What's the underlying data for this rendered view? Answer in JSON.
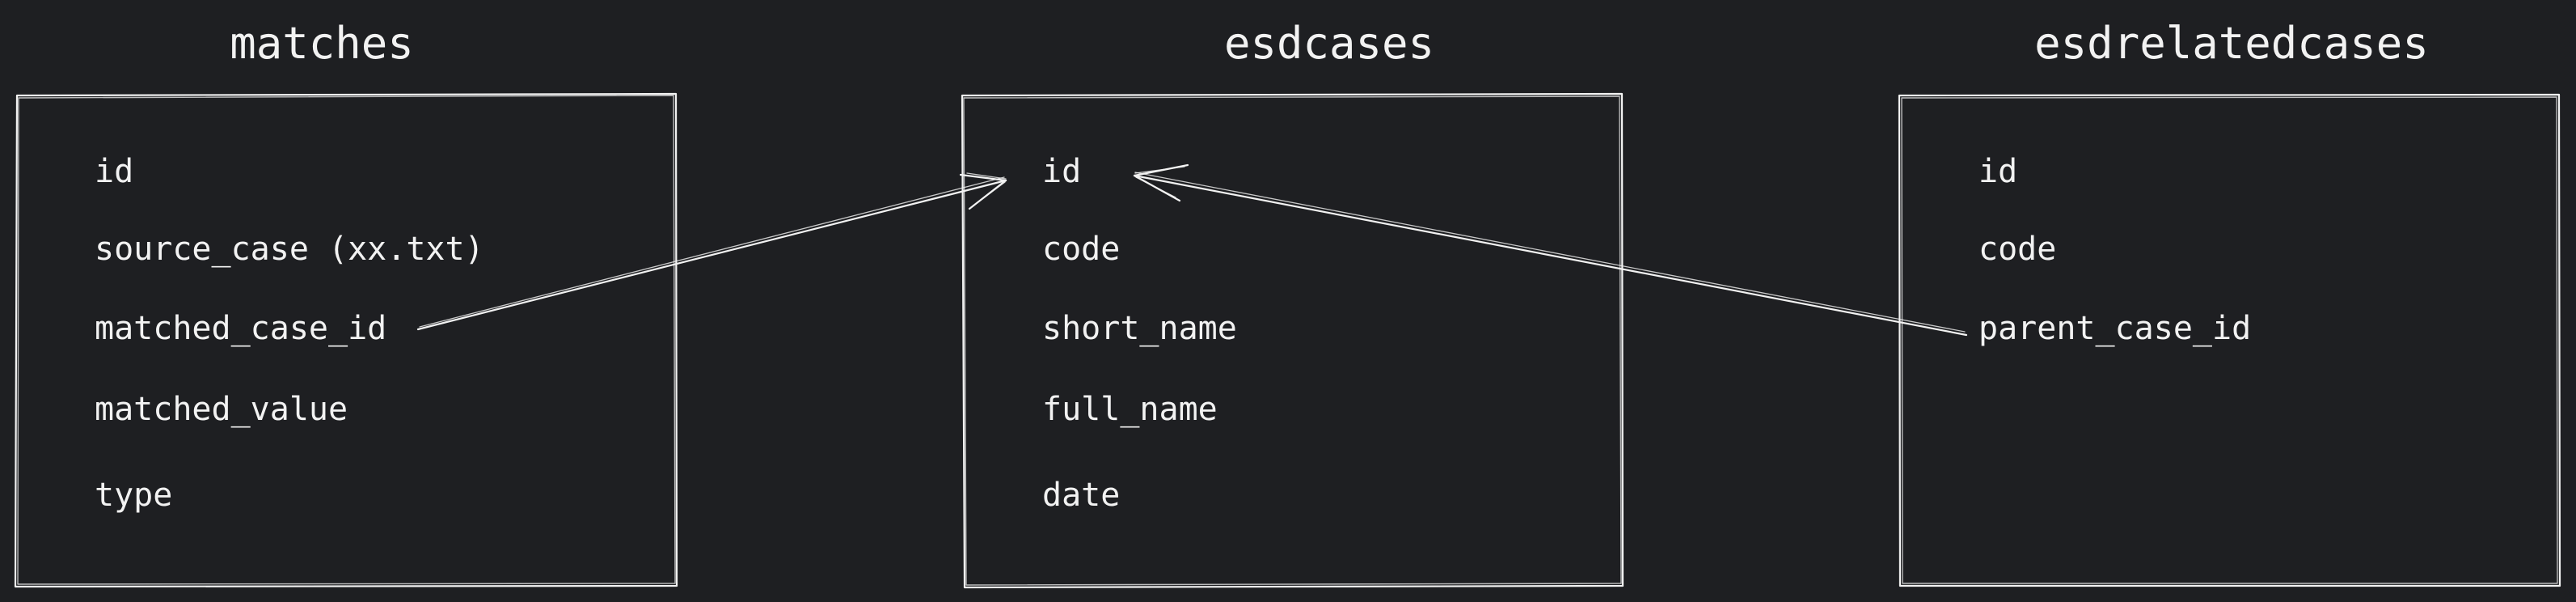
{
  "tables": [
    {
      "name": "matches",
      "fields": [
        "id",
        "source_case (xx.txt)",
        "matched_case_id",
        "matched_value",
        "type"
      ]
    },
    {
      "name": "esdcases",
      "fields": [
        "id",
        "code",
        "short_name",
        "full_name",
        "date"
      ]
    },
    {
      "name": "esdrelatedcases",
      "fields": [
        "id",
        "code",
        "parent_case_id"
      ]
    }
  ],
  "relations": [
    {
      "from": "matches.matched_case_id",
      "to": "esdcases.id"
    },
    {
      "from": "esdrelatedcases.parent_case_id",
      "to": "esdcases.id"
    }
  ],
  "colors": {
    "background": "#1e1f22",
    "stroke": "#f2f2f2",
    "text": "#f2f2f2"
  }
}
